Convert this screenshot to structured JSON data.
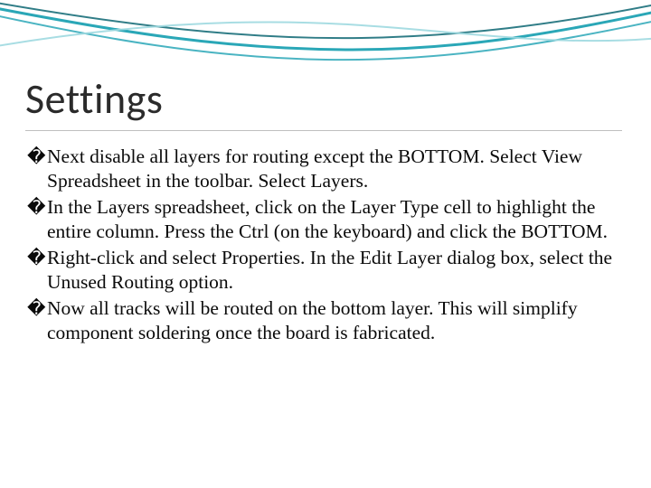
{
  "title": "Settings",
  "bullet_glyph": "�",
  "items": [
    "Next disable all layers for routing except the BOTTOM. Select View Spreadsheet in the toolbar. Select Layers.",
    "In the Layers spreadsheet, click on the Layer Type cell to highlight the entire column. Press the Ctrl (on the keyboard) and click the BOTTOM.",
    "Right-click and select Properties. In the Edit Layer dialog box, select the Unused Routing option.",
    "Now all tracks will be routed on the bottom layer. This will simplify component soldering once the board is fabricated."
  ]
}
